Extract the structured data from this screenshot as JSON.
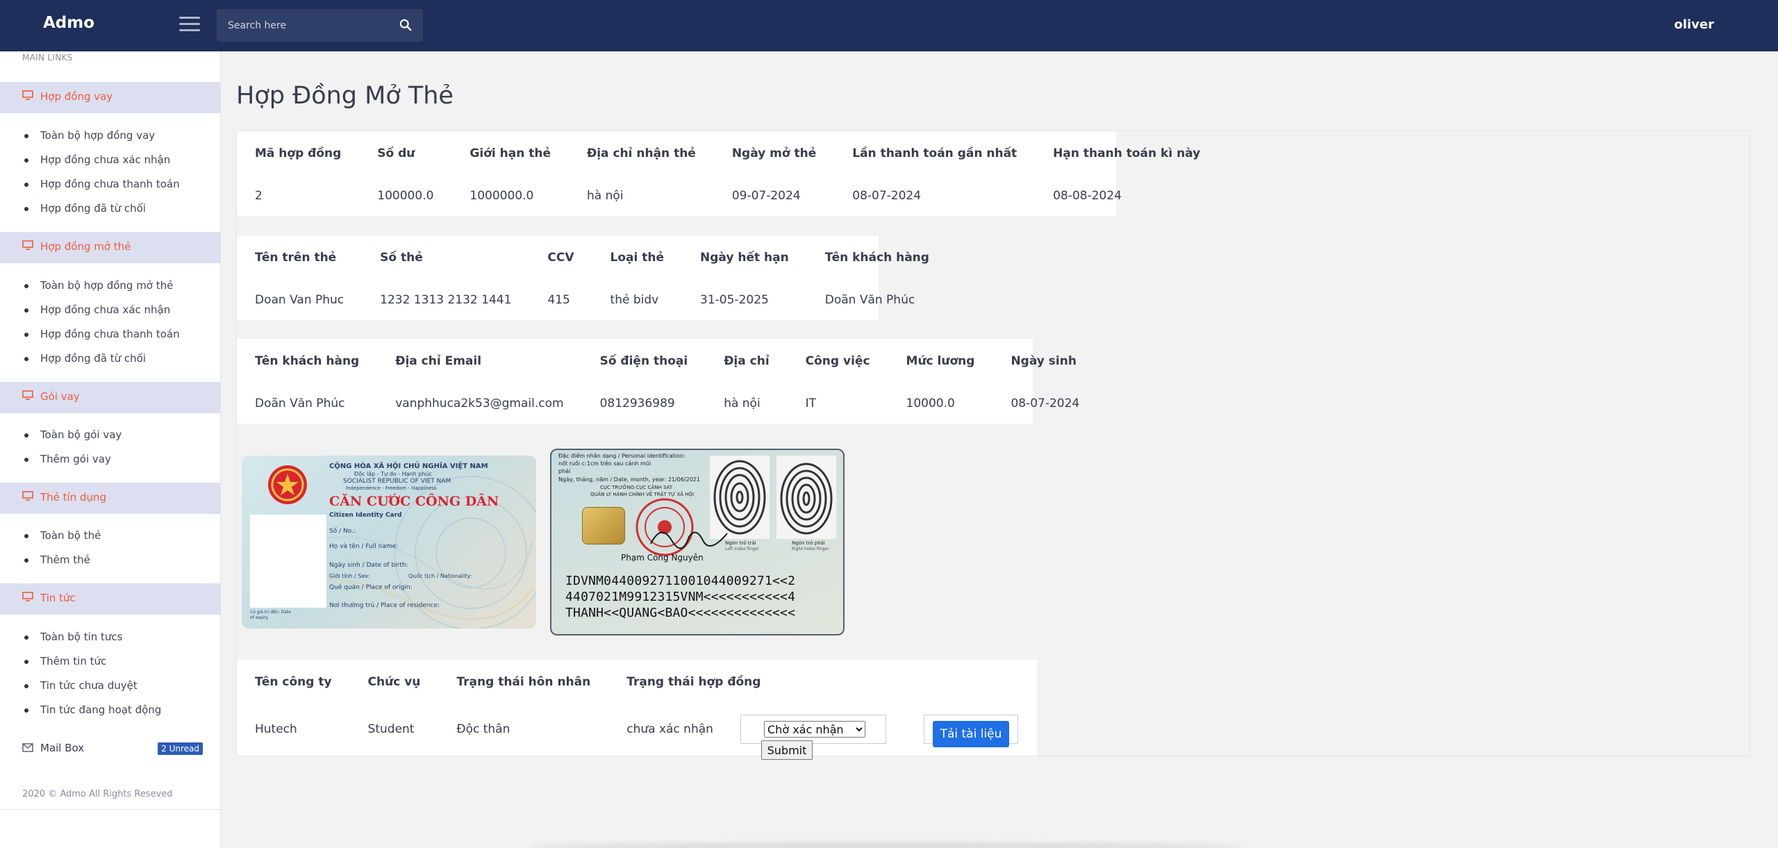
{
  "topbar": {
    "brand": "Admo",
    "search_placeholder": "Search here",
    "user": "oliver"
  },
  "sidebar": {
    "main_links": "MAIN LINKS",
    "sections": [
      {
        "label": "Hợp đồng vay",
        "items": [
          "Toàn bộ hợp đồng vay",
          "Hợp đồng chưa xác nhận",
          "Hợp đồng chưa thanh toán",
          "Hợp đồng đã từ chối"
        ]
      },
      {
        "label": "Hợp đồng mở thẻ",
        "items": [
          "Toàn bộ hợp đồng mở thẻ",
          "Hợp đồng chưa xác nhận",
          "Hợp đồng chưa thanh toán",
          "Hợp đồng đã từ chối"
        ]
      },
      {
        "label": "Gói vay",
        "items": [
          "Toàn bộ gói vay",
          "Thêm gói vay"
        ]
      },
      {
        "label": "Thẻ tín dụng",
        "items": [
          "Toàn bộ thẻ",
          "Thêm thẻ"
        ]
      },
      {
        "label": "Tin tức",
        "items": [
          "Toàn bộ tin tưcs",
          "Thêm tin tức",
          "Tin tức chưa duyệt",
          "Tin tức đang hoạt động"
        ]
      }
    ],
    "mailbox": {
      "label": "Mail Box",
      "badge": "2 Unread"
    },
    "copyright": "2020 © Admo All Rights Reseved"
  },
  "main": {
    "title": "Hợp Đồng Mở Thẻ",
    "contract": {
      "headers": [
        "Mã hợp đồng",
        "Số dư",
        "Giới hạn thẻ",
        "Địa chỉ nhận thẻ",
        "Ngày mở thẻ",
        "Lần thanh toán gần nhất",
        "Hạn thanh toán kì này"
      ],
      "values": [
        "2",
        "100000.0",
        "1000000.0",
        "hà nội",
        "09-07-2024",
        "08-07-2024",
        "08-08-2024"
      ]
    },
    "card": {
      "headers": [
        "Tên trên thẻ",
        "Số thẻ",
        "CCV",
        "Loại thẻ",
        "Ngày hết hạn",
        "Tên khách hàng"
      ],
      "values": [
        "Doan Van Phuc",
        "1232 1313 2132 1441",
        "415",
        "thẻ bidv",
        "31-05-2025",
        "Doãn Văn Phúc"
      ]
    },
    "customer": {
      "headers": [
        "Tên khách hàng",
        "Địa chỉ Email",
        "Số điện thoại",
        "Địa chỉ",
        "Công việc",
        "Mức lương",
        "Ngày sinh"
      ],
      "values": [
        "Doãn Văn Phúc",
        "vanphhuca2k53@gmail.com",
        "0812936989",
        "hà nội",
        "IT",
        "10000.0",
        "08-07-2024"
      ]
    },
    "id_front": {
      "country_vn": "CỘNG HÒA XÃ HỘI CHỦ NGHĨA VIỆT NAM",
      "motto_vn": "Độc lập - Tự do - Hạnh phúc",
      "country_en": "SOCIALIST REPUBLIC OF VIET NAM",
      "motto_en": "Independence - Freedom - Happiness",
      "title": "CĂN CƯỚC CÔNG DÂN",
      "subtitle": "Citizen Identity Card",
      "fields": [
        "Số / No.:",
        "Họ và tên / Full name:",
        "Ngày sinh / Date of birth:",
        "Giới tính / Sex:",
        "Quốc tịch / Nationality:",
        "Quê quán / Place of origin:",
        "Nơi thường trú / Place of residence:"
      ],
      "expiry": "Có giá trị đến: Date of expiry"
    },
    "id_back": {
      "line1": "Đặc điểm nhân dạng / Personal identification:",
      "line2": "nốt ruồi c:1cm trên sau cánh mũi",
      "line3": "phải",
      "line4": "Ngày, tháng, năm / Date, month, year: 21/06/2021",
      "line5": "CỤC TRƯỞNG CỤC CẢNH SÁT",
      "line6": "QUẢN LÝ HÀNH CHÍNH VỀ TRẬT TỰ XÃ HỘI",
      "signer": "Phạm Công Nguyên",
      "left_finger": "Ngón trỏ trái",
      "left_finger_en": "Left index finger",
      "right_finger": "Ngón trỏ phải",
      "right_finger_en": "Right index finger",
      "mrz1": "IDVNM0440092711001044009271<<2",
      "mrz2": "4407021M9912315VNM<<<<<<<<<<<4",
      "mrz3": "THANH<<QUANG<BAO<<<<<<<<<<<<<<"
    },
    "extra": {
      "headers": [
        "Tên công ty",
        "Chức vụ",
        "Trạng thái hôn nhân",
        "Trạng thái hợp đồng"
      ],
      "values": [
        "Hutech",
        "Student",
        "Độc thân",
        "chưa xác nhận"
      ]
    },
    "status_select": "Chờ xác nhận",
    "submit_label": "Submit",
    "upload_label": "Tải tài liệu"
  },
  "colors": {
    "topbar": "#1e2f5b",
    "accent": "#ee5b3e",
    "section_bg": "#dcdff0",
    "primary_button": "#1f6fe5"
  }
}
